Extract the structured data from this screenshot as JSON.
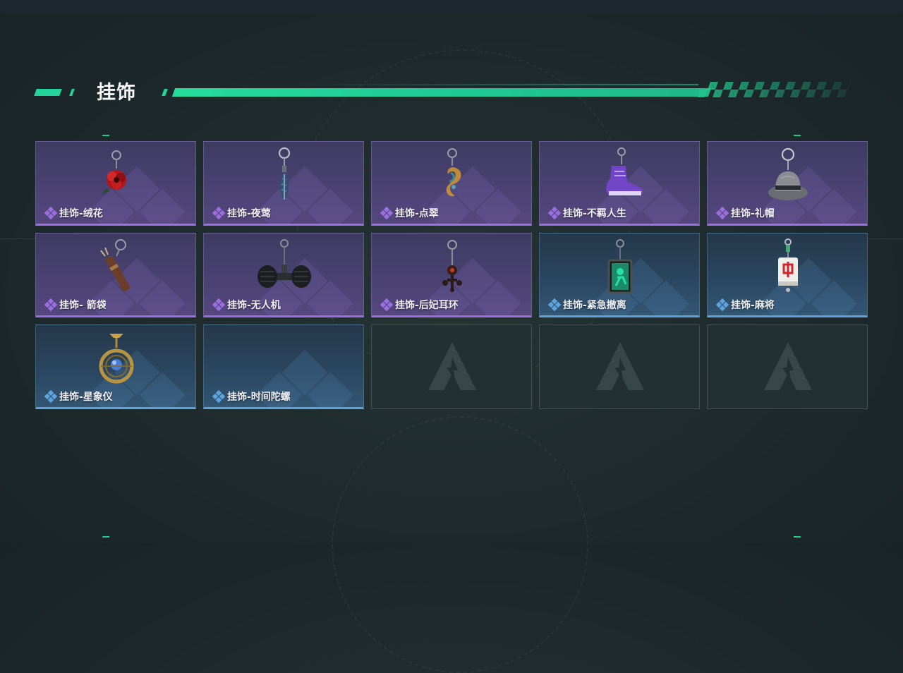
{
  "page": {
    "title": "挂饰"
  },
  "colors": {
    "accent_green": "#22d39a",
    "epic_purple": "#9b6fe0",
    "rare_blue": "#5ea3dc",
    "background": "#1f2b2d"
  },
  "items": [
    {
      "name": "挂饰-绒花",
      "rarity": "epic",
      "icon": "red-rose-charm-icon"
    },
    {
      "name": "挂饰-夜莺",
      "rarity": "epic",
      "icon": "blue-feather-charm-icon"
    },
    {
      "name": "挂饰-点翠",
      "rarity": "epic",
      "icon": "phoenix-ornament-charm-icon"
    },
    {
      "name": "挂饰-不羁人生",
      "rarity": "epic",
      "icon": "purple-sneaker-charm-icon"
    },
    {
      "name": "挂饰-礼帽",
      "rarity": "epic",
      "icon": "fedora-hat-charm-icon"
    },
    {
      "name": "挂饰- 箭袋",
      "rarity": "epic",
      "icon": "arrow-quiver-charm-icon"
    },
    {
      "name": "挂饰-无人机",
      "rarity": "epic",
      "icon": "wheeled-drone-charm-icon"
    },
    {
      "name": "挂饰-后妃耳环",
      "rarity": "epic",
      "icon": "consort-earring-charm-icon"
    },
    {
      "name": "挂饰-紧急撤离",
      "rarity": "rare",
      "icon": "emergency-exit-sign-charm-icon"
    },
    {
      "name": "挂饰-麻将",
      "rarity": "rare",
      "icon": "mahjong-tile-charm-icon"
    },
    {
      "name": "挂饰-星象仪",
      "rarity": "rare",
      "icon": "astrolabe-charm-icon"
    },
    {
      "name": "挂饰-时间陀螺",
      "rarity": "rare",
      "icon": "time-gyroscope-charm-icon"
    }
  ],
  "empty_slot_icon": "game-logo-placeholder-icon"
}
